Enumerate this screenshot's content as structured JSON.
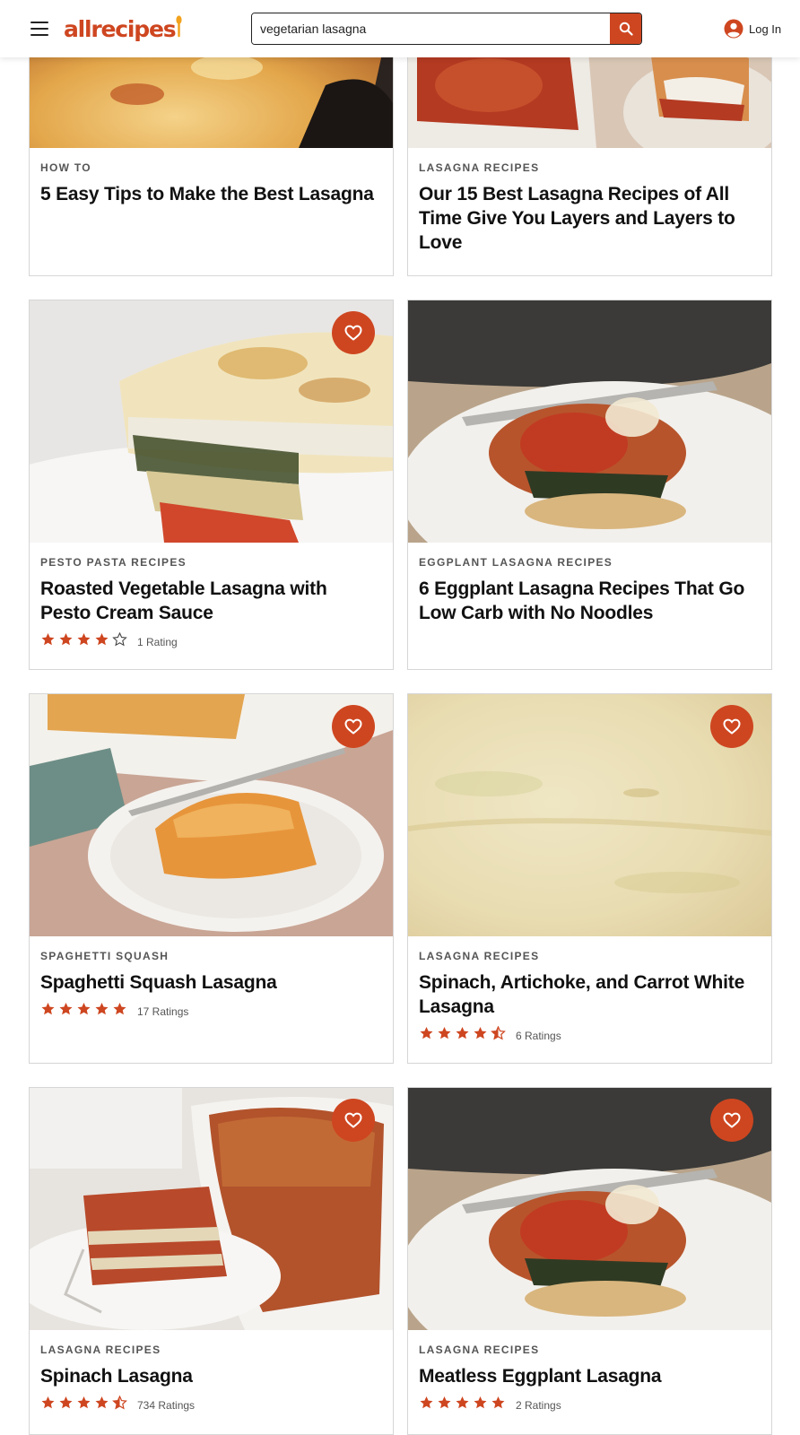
{
  "header": {
    "logo": "allrecipes",
    "search_value": "vegetarian lasagna",
    "login_label": "Log In"
  },
  "colors": {
    "brand": "#ce4620",
    "text": "#111111",
    "muted": "#555555",
    "border": "#d6d6d6"
  },
  "cards": [
    {
      "tag": "How To",
      "title": "5 Easy Tips to Make the Best Lasagna",
      "image": "lasagna-skillet-photo"
    },
    {
      "tag": "Lasagna Recipes",
      "title": "Our 15 Best Lasagna Recipes of All Time Give You Layers and Layers to Love",
      "image": "lasagna-dish-photo"
    },
    {
      "tag": "Pesto Pasta Recipes",
      "title": "Roasted Vegetable Lasagna with Pesto Cream Sauce",
      "rating": 4,
      "rating_text": "1 Rating",
      "image": "vegetable-lasagna-photo"
    },
    {
      "tag": "Eggplant Lasagna Recipes",
      "title": "6 Eggplant Lasagna Recipes That Go Low Carb with No Noodles",
      "image": "eggplant-lasagna-photo"
    },
    {
      "tag": "Spaghetti Squash",
      "title": "Spaghetti Squash Lasagna",
      "rating": 5,
      "rating_text": "17 Ratings",
      "image": "squash-lasagna-photo"
    },
    {
      "tag": "Lasagna Recipes",
      "title": "Spinach, Artichoke, and Carrot White Lasagna",
      "rating": 4.5,
      "rating_text": "6 Ratings",
      "image": "white-lasagna-photo"
    },
    {
      "tag": "Lasagna Recipes",
      "title": "Spinach Lasagna",
      "rating": 4.5,
      "rating_text": "734 Ratings",
      "image": "spinach-lasagna-photo"
    },
    {
      "tag": "Lasagna Recipes",
      "title": "Meatless Eggplant Lasagna",
      "rating": 5,
      "rating_text": "2 Ratings",
      "image": "meatless-eggplant-photo"
    }
  ]
}
